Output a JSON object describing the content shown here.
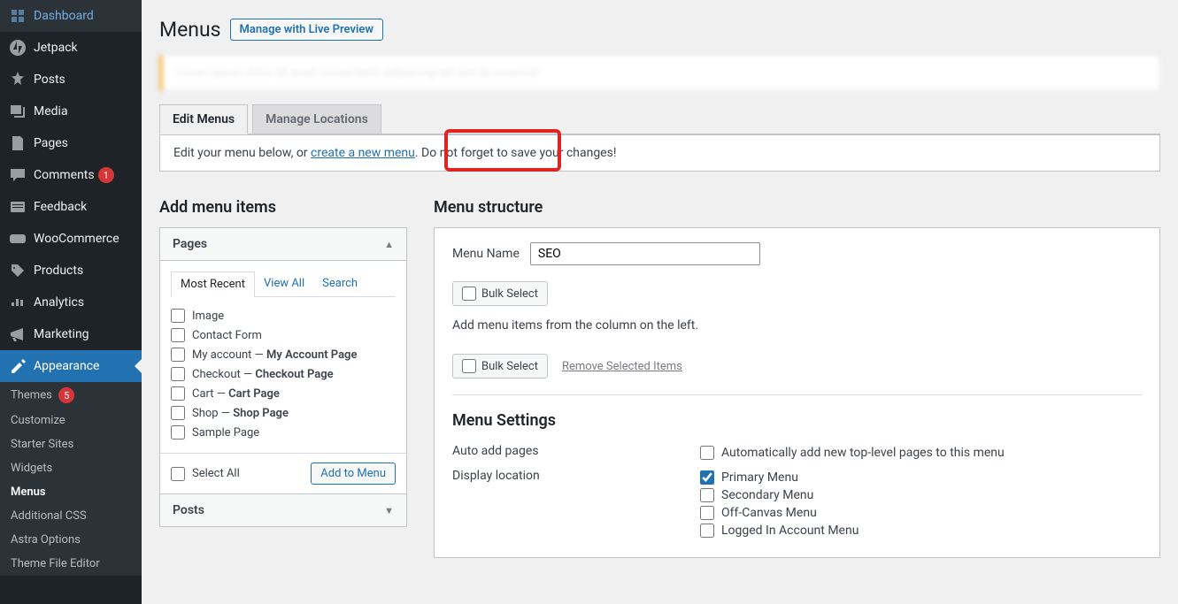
{
  "sidebar": {
    "items": [
      {
        "label": "Dashboard",
        "icon": "dashboard"
      },
      {
        "label": "Jetpack",
        "icon": "jetpack"
      },
      {
        "label": "Posts",
        "icon": "pin"
      },
      {
        "label": "Media",
        "icon": "media"
      },
      {
        "label": "Pages",
        "icon": "pages"
      },
      {
        "label": "Comments",
        "icon": "comment",
        "badge": "1"
      },
      {
        "label": "Feedback",
        "icon": "feedback"
      },
      {
        "label": "WooCommerce",
        "icon": "woo"
      },
      {
        "label": "Products",
        "icon": "products"
      },
      {
        "label": "Analytics",
        "icon": "analytics"
      },
      {
        "label": "Marketing",
        "icon": "marketing"
      },
      {
        "label": "Appearance",
        "icon": "appearance",
        "active": true
      }
    ],
    "submenu": [
      {
        "label": "Themes",
        "badge": "5"
      },
      {
        "label": "Customize"
      },
      {
        "label": "Starter Sites"
      },
      {
        "label": "Widgets"
      },
      {
        "label": "Menus",
        "current": true
      },
      {
        "label": "Additional CSS"
      },
      {
        "label": "Astra Options"
      },
      {
        "label": "Theme File Editor"
      }
    ]
  },
  "page": {
    "title": "Menus",
    "live_preview_btn": "Manage with Live Preview",
    "notice_blur": "Lorem ipsum dolor sit amet consectetur adipiscing elit sed do eiusmod"
  },
  "tabs": {
    "edit": "Edit Menus",
    "locations": "Manage Locations"
  },
  "info": {
    "before": "Edit your menu below, or ",
    "link": "create a new menu",
    "after": ". Do not forget to save your changes!"
  },
  "left": {
    "title": "Add menu items",
    "pages_header": "Pages",
    "subtabs": {
      "recent": "Most Recent",
      "viewall": "View All",
      "search": "Search"
    },
    "items": [
      {
        "label": "Image"
      },
      {
        "label": "Contact Form"
      },
      {
        "label": "My account",
        "suffix": "My Account Page"
      },
      {
        "label": "Checkout",
        "suffix": "Checkout Page"
      },
      {
        "label": "Cart",
        "suffix": "Cart Page"
      },
      {
        "label": "Shop",
        "suffix": "Shop Page"
      },
      {
        "label": "Sample Page"
      }
    ],
    "select_all": "Select All",
    "add_to_menu": "Add to Menu",
    "posts_header": "Posts"
  },
  "right": {
    "title": "Menu structure",
    "menu_name_label": "Menu Name",
    "menu_name_value": "SEO",
    "bulk_select": "Bulk Select",
    "helper": "Add menu items from the column on the left.",
    "remove_selected": "Remove Selected Items",
    "settings_title": "Menu Settings",
    "auto_add_label": "Auto add pages",
    "auto_add_option": "Automatically add new top-level pages to this menu",
    "display_label": "Display location",
    "locations": [
      {
        "label": "Primary Menu",
        "checked": true
      },
      {
        "label": "Secondary Menu",
        "checked": false
      },
      {
        "label": "Off-Canvas Menu",
        "checked": false
      },
      {
        "label": "Logged In Account Menu",
        "checked": false
      }
    ]
  }
}
